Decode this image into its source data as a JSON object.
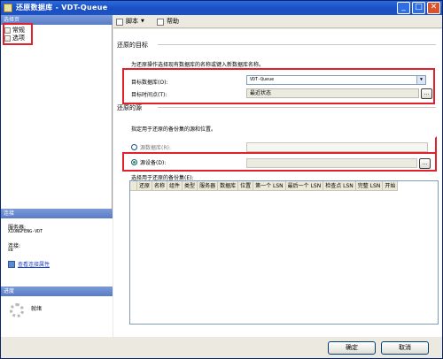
{
  "window": {
    "title": "还原数据库 - VDT-Queue"
  },
  "left": {
    "select_page_header": "选择页",
    "pages": [
      {
        "label": "常规"
      },
      {
        "label": "选项"
      }
    ],
    "connection_header": "连接",
    "server_label": "服务器:",
    "server_value": "XIONGFENG-VDT",
    "connection_label": "连接:",
    "connection_value": "sa",
    "view_props_link": "查看连接属性",
    "progress_header": "进度",
    "progress_status": "就绪"
  },
  "toolbar": {
    "script_label": "脚本",
    "help_label": "帮助"
  },
  "main": {
    "dest_section": "还原的目标",
    "dest_desc": "为还原操作选择现有数据库的名称或键入新数据库名称。",
    "target_db_label": "目标数据库(O):",
    "target_db_value": "VDT-Queue",
    "target_time_label": "目标时间点(T):",
    "target_time_value": "最近状态",
    "source_section": "还原的源",
    "source_desc": "指定用于还原的备份集的源和位置。",
    "from_db_label": "源数据库(R):",
    "from_device_label": "源设备(D):",
    "backup_sets_label": "选择用于还原的备份集(E):",
    "browse_label": "...",
    "grid_columns": [
      "还原",
      "名称",
      "组件",
      "类型",
      "服务器",
      "数据库",
      "位置",
      "第一个 LSN",
      "最后一个 LSN",
      "检查点 LSN",
      "完整 LSN",
      "开始"
    ]
  },
  "buttons": {
    "ok": "确定",
    "cancel": "取消"
  }
}
